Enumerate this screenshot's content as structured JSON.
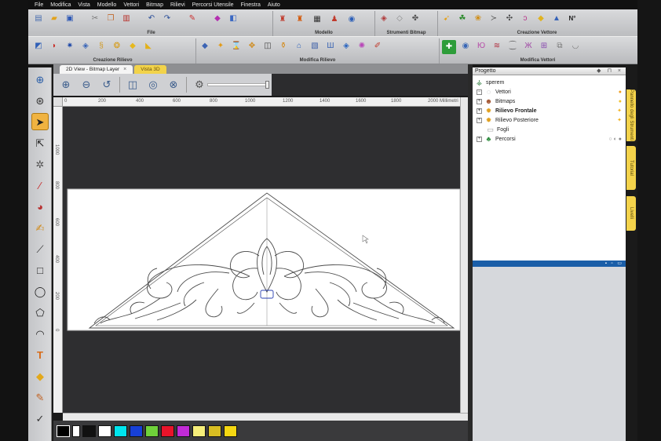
{
  "menubar": [
    "File",
    "Modifica",
    "Vista",
    "Modello",
    "Vettori",
    "Bitmap",
    "Rilievi",
    "Percorsi Utensile",
    "Finestra",
    "Aiuto"
  ],
  "ribbon1": {
    "file": "File",
    "modello": "Modello",
    "strumenti_bitmap": "Strumenti Bitmap",
    "creazione_vettore": "Creazione Vettore"
  },
  "ribbon2": {
    "creazione_rilievo": "Creazione Rilievo",
    "modifica_rilievo": "Modifica Rilievo",
    "modifica_vettori": "Modifica Vettori"
  },
  "tabs": {
    "view2d": "2D View - Bitmap Layer",
    "view3d": "Vista 3D"
  },
  "ruler": {
    "h_labels": [
      "0",
      "200",
      "400",
      "600",
      "800",
      "1000",
      "1200",
      "1400",
      "1600",
      "1800",
      "2000 Millimetri"
    ],
    "v_labels": [
      "1000",
      "800",
      "600",
      "400",
      "200",
      "0"
    ]
  },
  "palette": [
    "#000000",
    "#ffffff",
    "#111111",
    "#ffffff",
    "#00e5ee",
    "#1740d8",
    "#6fd13a",
    "#e8142a",
    "#c12bd6",
    "#f6ee7a",
    "#d8bd22",
    "#f5d712"
  ],
  "project": {
    "title": "Progetto",
    "root": "sperem",
    "items": [
      "Vettori",
      "Bitmaps",
      "Rilievo Frontale",
      "Rilievo Posteriore",
      "Fogli",
      "Percorsi"
    ]
  },
  "side_tabs": [
    "Pannello degli Strumenti",
    "Tutorial",
    "Livelli"
  ]
}
